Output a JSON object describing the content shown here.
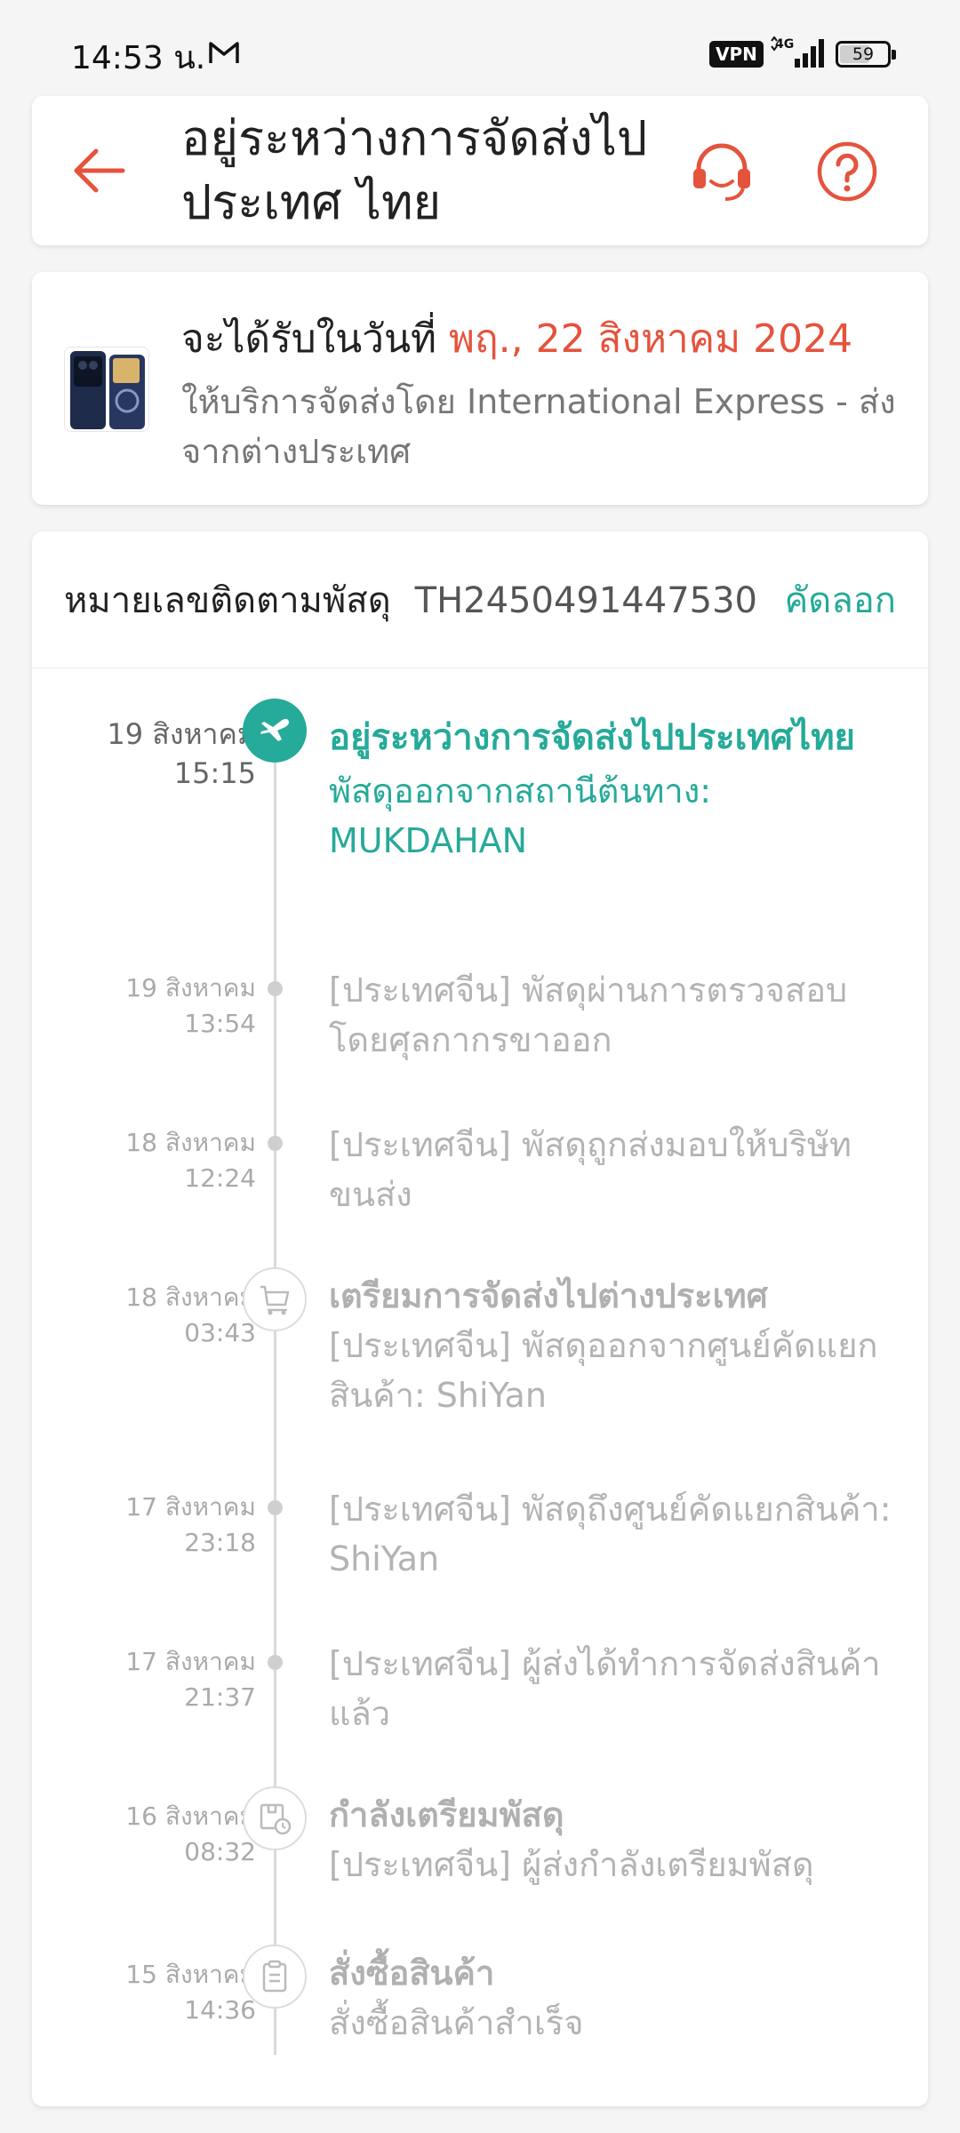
{
  "status_bar": {
    "time": "14:53 น.",
    "vpn": "VPN",
    "network": "4G",
    "battery": "59",
    "battery_level": 0.59
  },
  "header": {
    "title": "อยู่ระหว่างการจัดส่งไปประเทศ ไทย",
    "back_icon": "arrow-left-icon",
    "support_icon": "headset-icon",
    "help_icon": "question-circle-icon",
    "accent_color": "#e5533d"
  },
  "delivery": {
    "prefix": "จะได้รับในวันที่",
    "date": "พฤ., 22 สิงหาคม 2024",
    "service": "ให้บริการจัดส่งโดย International Express - ส่งจากต่างประเทศ"
  },
  "tracking": {
    "label": "หมายเลขติดตามพัสดุ",
    "number": "TH2450491447530",
    "copy_label": "คัดลอก",
    "accent_color": "#26aa99",
    "events": [
      {
        "date": "19 สิงหาคม",
        "time": "15:15",
        "title": "อยู่ระหว่างการจัดส่งไปประเทศไทย",
        "desc": "พัสดุออกจากสถานีต้นทาง: MUKDAHAN",
        "icon": "plane-icon",
        "active": true
      },
      {
        "date": "19 สิงหาคม",
        "time": "13:54",
        "title": "",
        "desc": "[ประเทศจีน] พัสดุผ่านการตรวจสอบโดยศุลกากรขาออก"
      },
      {
        "date": "18 สิงหาคม",
        "time": "12:24",
        "title": "",
        "desc": "[ประเทศจีน] พัสดุถูกส่งมอบให้บริษัทขนส่ง"
      },
      {
        "date": "18 สิงหาคม",
        "time": "03:43",
        "title": "เตรียมการจัดส่งไปต่างประเทศ",
        "desc": "[ประเทศจีน] พัสดุออกจากศูนย์คัดแยกสินค้า: ShiYan",
        "icon": "cart-icon"
      },
      {
        "date": "17 สิงหาคม",
        "time": "23:18",
        "title": "",
        "desc": "[ประเทศจีน] พัสดุถึงศูนย์คัดแยกสินค้า: ShiYan"
      },
      {
        "date": "17 สิงหาคม",
        "time": "21:37",
        "title": "",
        "desc": "[ประเทศจีน] ผู้ส่งได้ทำการจัดส่งสินค้าแล้ว"
      },
      {
        "date": "16 สิงหาคม",
        "time": "08:32",
        "title": "กำลังเตรียมพัสดุ",
        "desc": "[ประเทศจีน] ผู้ส่งกำลังเตรียมพัสดุ",
        "icon": "package-clock-icon"
      },
      {
        "date": "15 สิงหาคม",
        "time": "14:36",
        "title": "สั่งซื้อสินค้า",
        "desc": "สั่งซื้อสินค้าสำเร็จ",
        "icon": "clipboard-icon"
      }
    ]
  }
}
